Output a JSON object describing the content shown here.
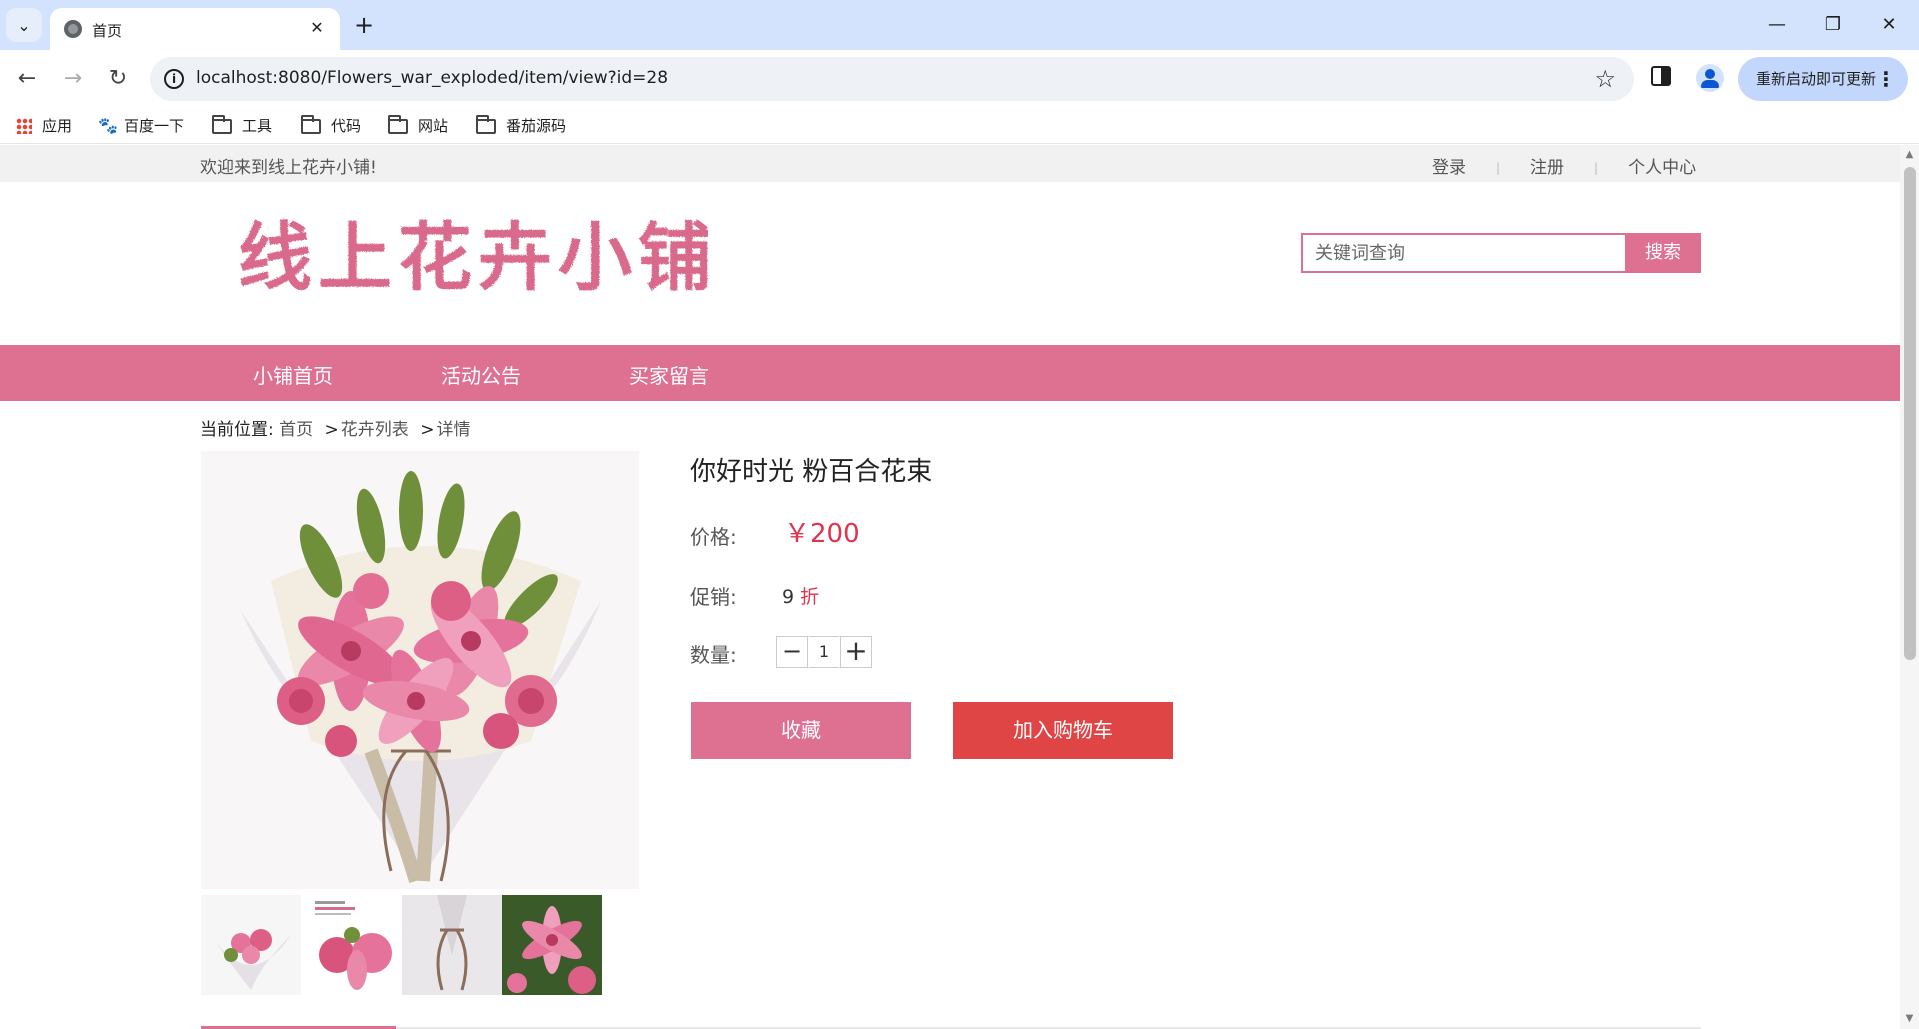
{
  "browser": {
    "tab_title": "首页",
    "tab_close": "✕",
    "new_tab": "+",
    "url": "localhost:8080/Flowers_war_exploded/item/view?id=28",
    "update_label": "重新启动即可更新",
    "minimize": "—",
    "restore": "❐",
    "close": "✕",
    "bookmarks": [
      "应用",
      "百度一下",
      "工具",
      "代码",
      "网站",
      "番茄源码"
    ]
  },
  "header": {
    "welcome": "欢迎来到线上花卉小铺!",
    "links": [
      "登录",
      "注册",
      "个人中心"
    ],
    "logo_text": "线上花卉小铺",
    "search_placeholder": "关键词查询",
    "search_button": "搜索"
  },
  "nav": {
    "items": [
      "小铺首页",
      "活动公告",
      "买家留言"
    ]
  },
  "breadcrumb": {
    "prefix": "当前位置:",
    "home": "首页",
    "list": "花卉列表",
    "current": "详情",
    "sep": ">"
  },
  "product": {
    "title": "你好时光 粉百合花束",
    "price_label": "价格:",
    "price": "￥200",
    "promo_label": "促销:",
    "discount": "9",
    "discount_unit": "折",
    "qty_label": "数量:",
    "quantity": "1",
    "minus": "−",
    "plus": "+",
    "favorite_button": "收藏",
    "cart_button": "加入购物车"
  },
  "colors": {
    "brand_pink": "#de7092",
    "cart_red": "#e04545",
    "price_red": "#e0334d"
  }
}
